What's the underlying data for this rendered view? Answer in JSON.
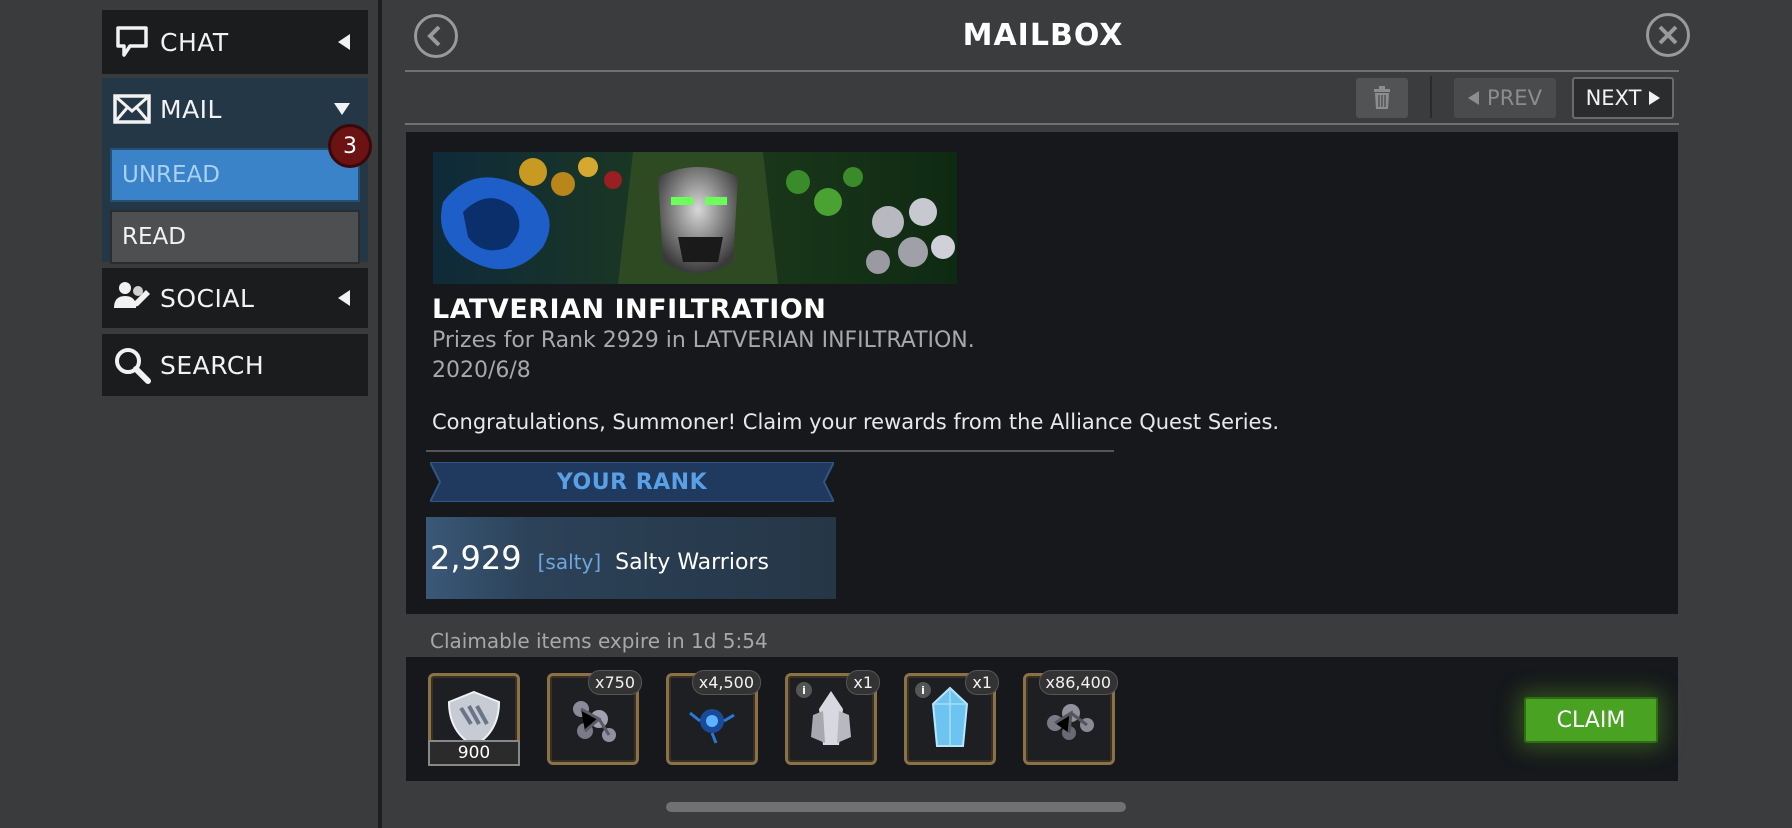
{
  "sidebar": {
    "chat_label": "CHAT",
    "mail_label": "MAIL",
    "unread_label": "UNREAD",
    "unread_count": "3",
    "read_label": "READ",
    "social_label": "SOCIAL",
    "search_label": "SEARCH"
  },
  "header": {
    "title": "MAILBOX"
  },
  "toolbar": {
    "prev_label": "PREV",
    "next_label": "NEXT"
  },
  "mail": {
    "title": "LATVERIAN INFILTRATION",
    "subtitle": "Prizes for Rank 2929 in LATVERIAN INFILTRATION.",
    "date": "2020/6/8",
    "body": "Congratulations, Summoner! Claim your rewards from the Alliance Quest Series.",
    "rank_header": "YOUR RANK",
    "rank_value": "2,929",
    "alliance_tag": "[salty]",
    "alliance_name": "Salty Warriors"
  },
  "rewards": {
    "expire_text": "Claimable items expire in 1d 5:54",
    "claim_label": "CLAIM",
    "items": [
      {
        "icon": "alliance-shield-icon",
        "count": "900"
      },
      {
        "icon": "catalyst-fragments-icon",
        "qty": "x750"
      },
      {
        "icon": "blue-catalyst-icon",
        "qty": "x4,500"
      },
      {
        "icon": "silver-crystal-icon",
        "qty": "x1"
      },
      {
        "icon": "blue-crystal-icon",
        "qty": "x1"
      },
      {
        "icon": "gray-catalyst-icon",
        "qty": "x86,400"
      }
    ]
  },
  "colors": {
    "accent_blue": "#3a83c9",
    "claim_green": "#49a222",
    "badge_red": "#6b1212",
    "item_border_gold": "#8b7148"
  }
}
